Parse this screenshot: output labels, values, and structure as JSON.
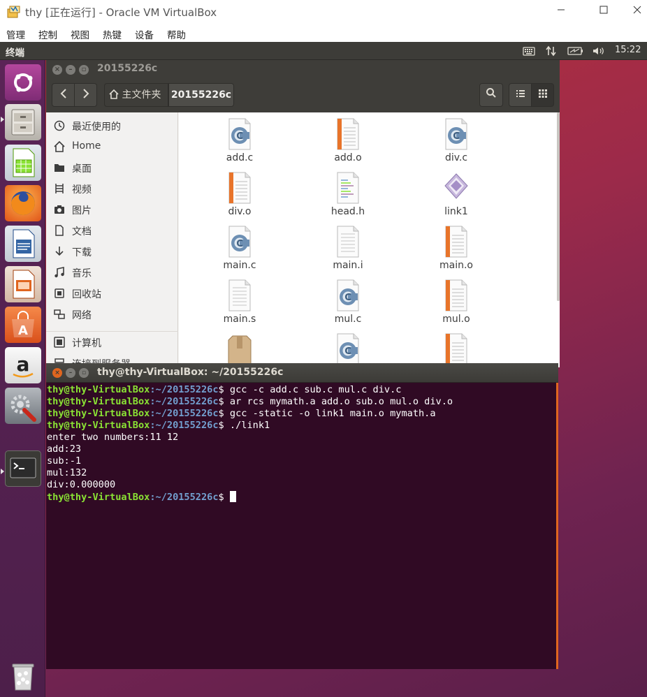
{
  "vbox": {
    "title": "thy [正在运行] - Oracle VM VirtualBox",
    "menu": [
      "管理",
      "控制",
      "视图",
      "热键",
      "设备",
      "帮助"
    ]
  },
  "topbar": {
    "app_title": "终端",
    "time": "15:22"
  },
  "nautilus": {
    "title": "20155226c",
    "breadcrumb_home": "主文件夹",
    "breadcrumb_current": "20155226c",
    "sidebar": [
      {
        "icon": "clock-icon",
        "label": "最近使用的"
      },
      {
        "icon": "home-icon",
        "label": "Home"
      },
      {
        "icon": "folder-icon",
        "label": "桌面"
      },
      {
        "icon": "video-icon",
        "label": "视频"
      },
      {
        "icon": "camera-icon",
        "label": "图片"
      },
      {
        "icon": "document-icon",
        "label": "文档"
      },
      {
        "icon": "download-icon",
        "label": "下载"
      },
      {
        "icon": "music-icon",
        "label": "音乐"
      },
      {
        "icon": "trash-icon",
        "label": "回收站"
      },
      {
        "icon": "network-icon",
        "label": "网络"
      },
      {
        "icon": "computer-icon",
        "label": "计算机"
      },
      {
        "icon": "server-icon",
        "label": "连接到服务器"
      }
    ],
    "files": [
      {
        "name": "add.c",
        "type": "c"
      },
      {
        "name": "add.o",
        "type": "o"
      },
      {
        "name": "div.c",
        "type": "c"
      },
      {
        "name": "div.o",
        "type": "o"
      },
      {
        "name": "head.h",
        "type": "h"
      },
      {
        "name": "link1",
        "type": "exe"
      },
      {
        "name": "main.c",
        "type": "c"
      },
      {
        "name": "main.i",
        "type": "text"
      },
      {
        "name": "main.o",
        "type": "o"
      },
      {
        "name": "main.s",
        "type": "text"
      },
      {
        "name": "mul.c",
        "type": "c"
      },
      {
        "name": "mul.o",
        "type": "o"
      },
      {
        "name": "",
        "type": "archive"
      },
      {
        "name": "",
        "type": "c"
      },
      {
        "name": "",
        "type": "o"
      }
    ]
  },
  "terminal": {
    "title": "thy@thy-VirtualBox: ~/20155226c",
    "prompt_user": "thy@thy-VirtualBox",
    "prompt_path": ":~/20155226c",
    "prompt_sym": "$ ",
    "lines": [
      {
        "kind": "cmd",
        "text": "gcc -c add.c sub.c mul.c div.c"
      },
      {
        "kind": "cmd",
        "text": "ar rcs mymath.a add.o sub.o mul.o div.o"
      },
      {
        "kind": "cmd",
        "text": "gcc -static -o link1 main.o mymath.a"
      },
      {
        "kind": "cmd",
        "text": "./link1"
      },
      {
        "kind": "out",
        "text": "enter two numbers:11 12"
      },
      {
        "kind": "out",
        "text": "add:23"
      },
      {
        "kind": "out",
        "text": "sub:-1"
      },
      {
        "kind": "out",
        "text": "mul:132"
      },
      {
        "kind": "out",
        "text": "div:0.000000"
      },
      {
        "kind": "prompt",
        "text": ""
      }
    ]
  },
  "colors": {
    "terminal_bg": "#300a24",
    "prompt_user": "#8ae234",
    "prompt_path": "#729fcf",
    "accent_orange": "#e0651f"
  }
}
